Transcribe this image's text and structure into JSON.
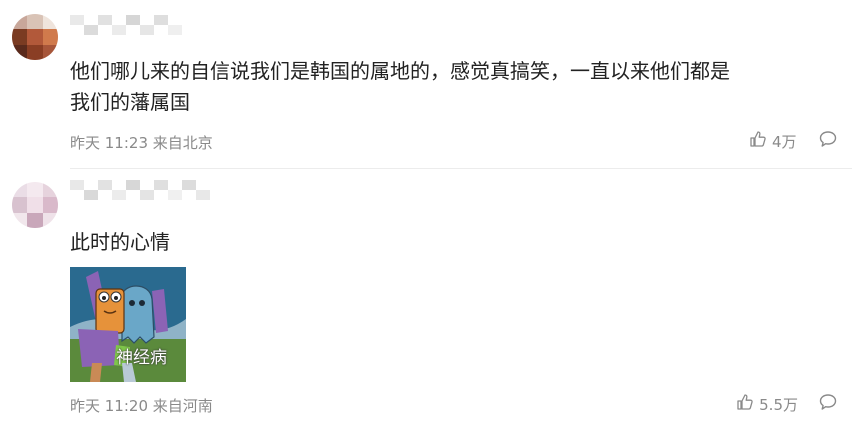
{
  "comments": [
    {
      "username": "",
      "content": "他们哪儿来的自信说我们是韩国的属地的，感觉真搞笑，一直以来他们都是\n我们的藩属国",
      "time": "昨天 11:23",
      "location": "来自北京",
      "likes": "4万",
      "like_icon": "thumbs-up-icon",
      "reply_icon": "comment-bubble-icon"
    },
    {
      "username": "",
      "content": "此时的心情",
      "sticker_text": "神经病",
      "time": "昨天 11:20",
      "location": "来自河南",
      "likes": "5.5万",
      "like_icon": "thumbs-up-icon",
      "reply_icon": "comment-bubble-icon"
    }
  ],
  "colors": {
    "text": "#222222",
    "meta": "#8a8a8a",
    "divider": "#ececec"
  }
}
